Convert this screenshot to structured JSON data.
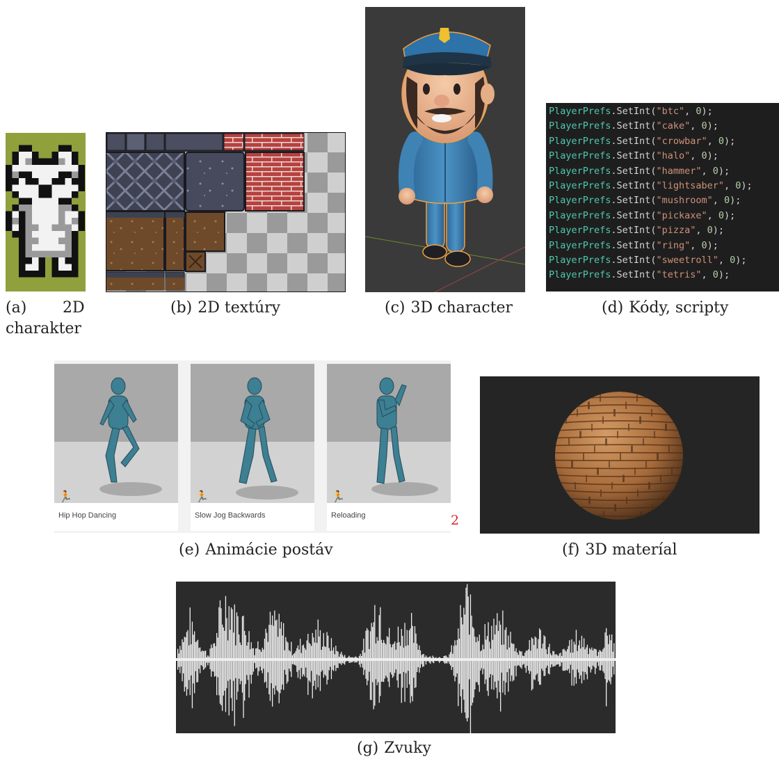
{
  "figures": [
    {
      "label": "(a)",
      "caption": "2D charakter"
    },
    {
      "label": "(b)",
      "caption": "2D textúry"
    },
    {
      "label": "(c)",
      "caption": "3D character"
    },
    {
      "label": "(d)",
      "caption": "Kódy, scripty"
    },
    {
      "label": "(e)",
      "caption": "Animácie postáv"
    },
    {
      "label": "(f)",
      "caption": "3D materíal"
    },
    {
      "label": "(g)",
      "caption": "Zvuky"
    }
  ],
  "code_lines": [
    {
      "cls": "PlayerPrefs",
      "fn": "SetInt",
      "key": "\"btc\"",
      "val": "0"
    },
    {
      "cls": "PlayerPrefs",
      "fn": "SetInt",
      "key": "\"cake\"",
      "val": "0"
    },
    {
      "cls": "PlayerPrefs",
      "fn": "SetInt",
      "key": "\"crowbar\"",
      "val": "0"
    },
    {
      "cls": "PlayerPrefs",
      "fn": "SetInt",
      "key": "\"halo\"",
      "val": "0"
    },
    {
      "cls": "PlayerPrefs",
      "fn": "SetInt",
      "key": "\"hammer\"",
      "val": "0"
    },
    {
      "cls": "PlayerPrefs",
      "fn": "SetInt",
      "key": "\"lightsaber\"",
      "val": "0"
    },
    {
      "cls": "PlayerPrefs",
      "fn": "SetInt",
      "key": "\"mushroom\"",
      "val": "0"
    },
    {
      "cls": "PlayerPrefs",
      "fn": "SetInt",
      "key": "\"pickaxe\"",
      "val": "0"
    },
    {
      "cls": "PlayerPrefs",
      "fn": "SetInt",
      "key": "\"pizza\"",
      "val": "0"
    },
    {
      "cls": "PlayerPrefs",
      "fn": "SetInt",
      "key": "\"ring\"",
      "val": "0"
    },
    {
      "cls": "PlayerPrefs",
      "fn": "SetInt",
      "key": "\"sweetroll\"",
      "val": "0"
    },
    {
      "cls": "PlayerPrefs",
      "fn": "SetInt",
      "key": "\"tetris\"",
      "val": "0"
    }
  ],
  "animations": [
    {
      "name": "Hip Hop Dancing",
      "icon": "running-figure-icon"
    },
    {
      "name": "Slow Jog Backwards",
      "icon": "running-figure-icon"
    },
    {
      "name": "Reloading",
      "icon": "running-figure-icon"
    }
  ],
  "animation_footnote": "2",
  "colors": {
    "code_class": "#4ec9b0",
    "code_string": "#ce9178",
    "code_number": "#b5cea8",
    "footnote": "#d9262a",
    "raccoon_bg": "#8fa03d"
  }
}
